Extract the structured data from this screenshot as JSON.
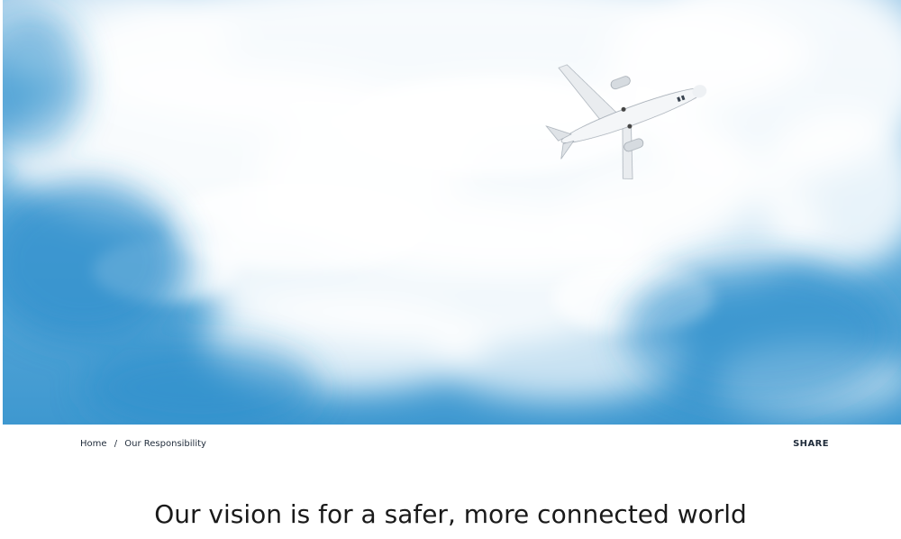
{
  "hero": {
    "image_subject": "airplane flying in a cloudy blue sky",
    "sky_color": "#4aa2d6",
    "cloud_color": "#ffffff"
  },
  "breadcrumb": {
    "items": [
      "Home",
      "Our Responsibility"
    ],
    "separator": "/"
  },
  "share": {
    "label": "SHARE"
  },
  "main": {
    "headline": "Our vision is for a safer, more connected world"
  },
  "colors": {
    "text_dark": "#1f2b3a",
    "headline": "#1a1a1a",
    "background": "#ffffff"
  }
}
